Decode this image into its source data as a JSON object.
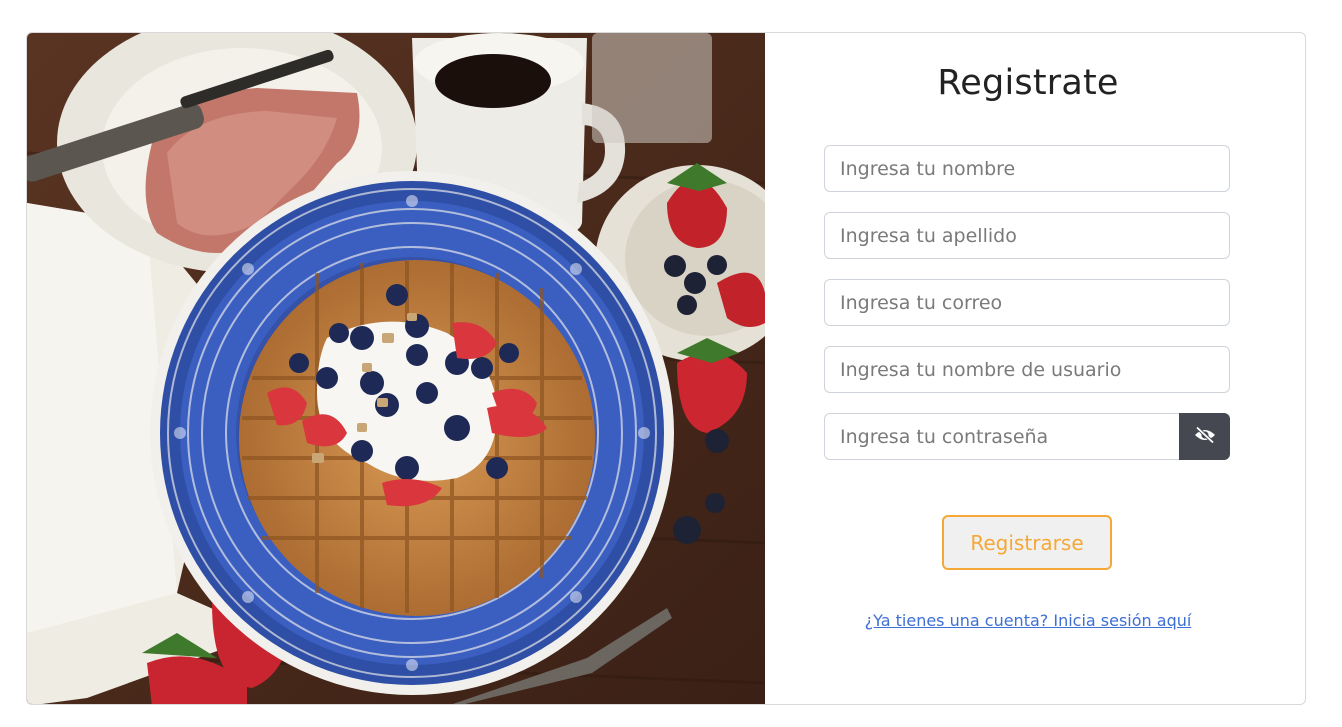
{
  "form": {
    "title": "Registrate",
    "fields": {
      "first_name_placeholder": "Ingresa tu nombre",
      "last_name_placeholder": "Ingresa tu apellido",
      "email_placeholder": "Ingresa tu correo",
      "username_placeholder": "Ingresa tu nombre de usuario",
      "password_placeholder": "Ingresa tu contraseña"
    },
    "toggle_password_icon": "eye-slash-icon",
    "submit_label": "Registrarse",
    "login_link": "¿Ya tienes una cuenta? Inicia sesión aquí"
  },
  "colors": {
    "accent": "#f5a836",
    "link": "#3d6fd6",
    "toggle_bg": "#454851",
    "border": "#ced4da"
  }
}
